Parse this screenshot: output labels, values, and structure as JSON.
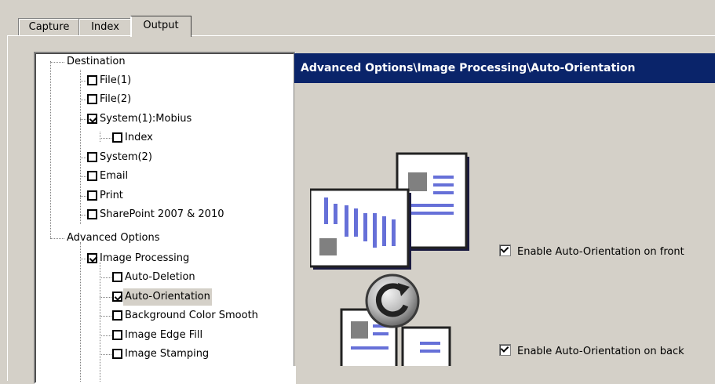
{
  "tabs": [
    {
      "label": "Capture",
      "active": false
    },
    {
      "label": "Index",
      "active": false
    },
    {
      "label": "Output",
      "active": true
    }
  ],
  "tree": {
    "items": [
      {
        "label": "Destination",
        "checkbox": false,
        "checked": false
      },
      {
        "label": "File(1)",
        "checkbox": true,
        "checked": false
      },
      {
        "label": "File(2)",
        "checkbox": true,
        "checked": false
      },
      {
        "label": "System(1):Mobius",
        "checkbox": true,
        "checked": true
      },
      {
        "label": "Index",
        "checkbox": true,
        "checked": false
      },
      {
        "label": "System(2)",
        "checkbox": true,
        "checked": false
      },
      {
        "label": "Email",
        "checkbox": true,
        "checked": false
      },
      {
        "label": "Print",
        "checkbox": true,
        "checked": false
      },
      {
        "label": "SharePoint 2007 & 2010",
        "checkbox": true,
        "checked": false
      },
      {
        "label": "Advanced Options",
        "checkbox": false,
        "checked": false
      },
      {
        "label": "Image Processing",
        "checkbox": true,
        "checked": true
      },
      {
        "label": "Auto-Deletion",
        "checkbox": true,
        "checked": false
      },
      {
        "label": "Auto-Orientation",
        "checkbox": true,
        "checked": true,
        "selected": true
      },
      {
        "label": "Background Color Smooth",
        "checkbox": true,
        "checked": false
      },
      {
        "label": "Image Edge Fill",
        "checkbox": true,
        "checked": false
      },
      {
        "label": "Image Stamping",
        "checkbox": true,
        "checked": false
      }
    ]
  },
  "panel": {
    "header": "Advanced Options\\Image Processing\\Auto-Orientation",
    "options": [
      {
        "label": "Enable Auto-Orientation on front",
        "checked": true
      },
      {
        "label": "Enable Auto-Orientation on back",
        "checked": true
      }
    ],
    "illustration_icon": "auto-orientation-documents-icon"
  },
  "colors": {
    "window_bg": "#d4d0c8",
    "header_bg": "#0a246a",
    "header_text": "#ffffff",
    "doc_blue": "#6670d8"
  }
}
